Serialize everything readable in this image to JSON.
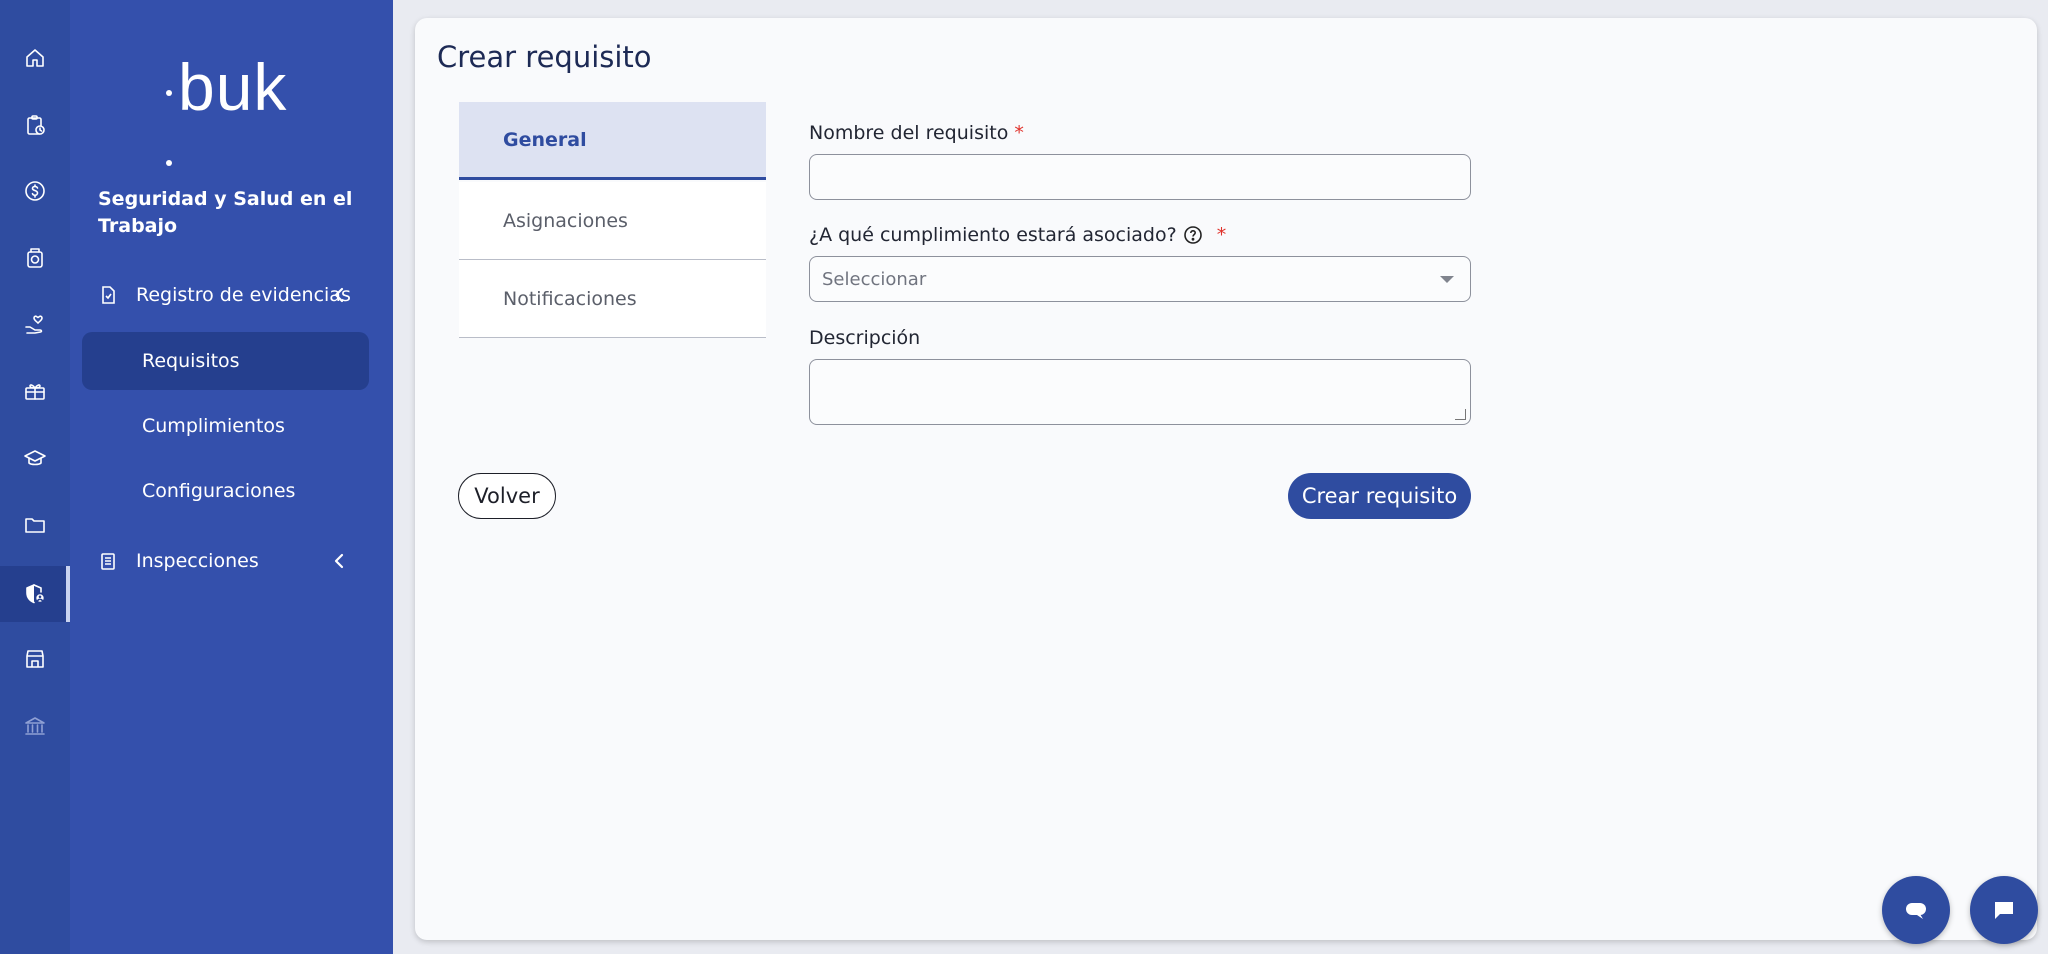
{
  "app": {
    "logo_text": "buk",
    "accent": "#2f4ca0"
  },
  "rail": {
    "icons": [
      "home-icon",
      "clipboard-clock-icon",
      "dollar-icon",
      "wallet-icon",
      "hand-heart-icon",
      "gift-icon",
      "graduation-cap-icon",
      "folder-icon",
      "shield-user-icon",
      "store-icon",
      "bank-icon"
    ],
    "active": "shield-user-icon"
  },
  "sidebar": {
    "module_title": "Seguridad y Salud en el Trabajo",
    "groups": [
      {
        "label": "Registro de evidencias",
        "items": [
          "Requisitos",
          "Cumplimientos",
          "Configuraciones"
        ],
        "active_item": "Requisitos"
      },
      {
        "label": "Inspecciones"
      }
    ]
  },
  "main": {
    "title": "Crear requisito",
    "tabs": [
      "General",
      "Asignaciones",
      "Notificaciones"
    ],
    "active_tab": "General",
    "form": {
      "name_label": "Nombre del requisito",
      "name_value": "",
      "compliance_label": "¿A qué cumplimiento estará asociado?",
      "compliance_placeholder": "Seleccionar",
      "description_label": "Descripción",
      "description_value": "",
      "required_mark": "*"
    },
    "back_button": "Volver",
    "create_button": "Crear requisito"
  }
}
